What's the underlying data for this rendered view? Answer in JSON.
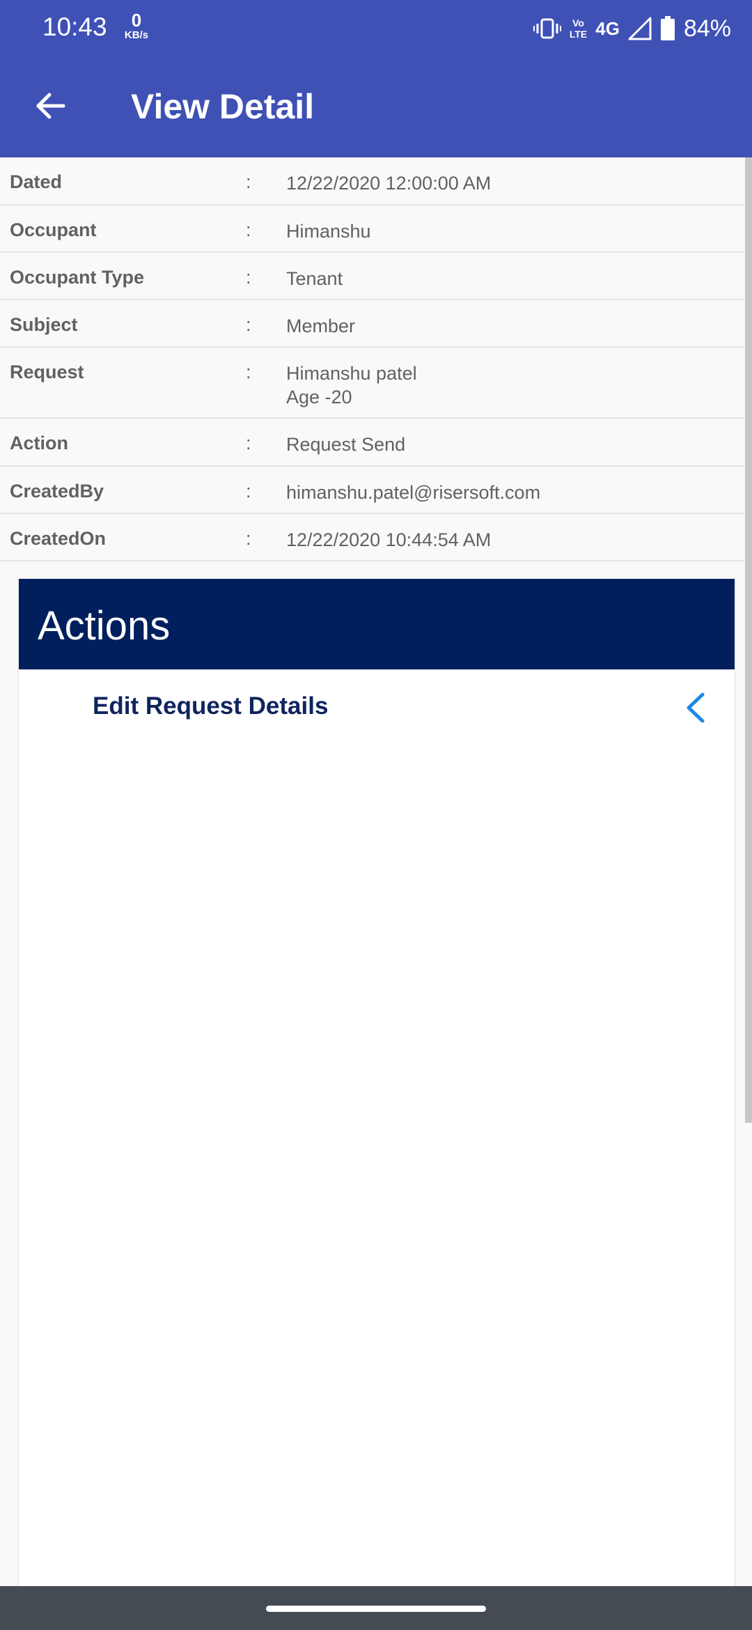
{
  "status_bar": {
    "time": "10:43",
    "net_speed_value": "0",
    "net_speed_unit": "KB/s",
    "volte_top": "Vo",
    "volte_bottom": "LTE",
    "network": "4G",
    "battery_pct": "84%"
  },
  "app_bar": {
    "title": "View Detail"
  },
  "details": [
    {
      "label": "Dated",
      "colon": ":",
      "value": [
        "12/22/2020 12:00:00 AM"
      ]
    },
    {
      "label": "Occupant",
      "colon": ":",
      "value": [
        "Himanshu"
      ]
    },
    {
      "label": "Occupant Type",
      "colon": ":",
      "value": [
        "Tenant"
      ]
    },
    {
      "label": "Subject",
      "colon": ":",
      "value": [
        "Member"
      ]
    },
    {
      "label": "Request",
      "colon": ":",
      "value": [
        "Himanshu patel",
        "Age -20"
      ]
    },
    {
      "label": "Action",
      "colon": ":",
      "value": [
        "Request Send"
      ]
    },
    {
      "label": "CreatedBy",
      "colon": ":",
      "value": [
        "himanshu.patel@risersoft.com"
      ]
    },
    {
      "label": "CreatedOn",
      "colon": ":",
      "value": [
        "12/22/2020 10:44:54 AM"
      ]
    }
  ],
  "actions": {
    "title": "Actions",
    "items": [
      {
        "label": "Edit Request Details",
        "icon": "chevron-left-icon"
      }
    ]
  },
  "colors": {
    "app_bar": "#3f51b5",
    "actions_header": "#001f5c",
    "action_text": "#0e245c",
    "chevron": "#1e88e5"
  }
}
